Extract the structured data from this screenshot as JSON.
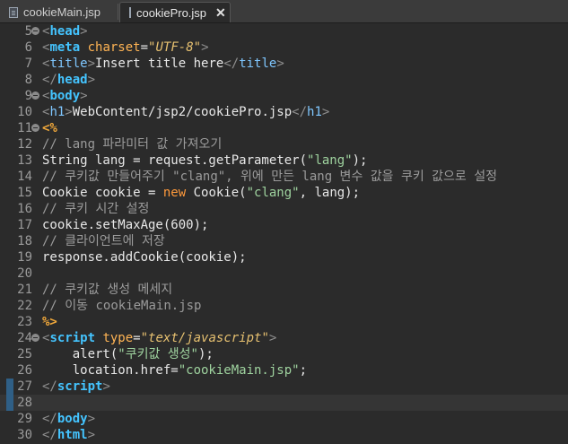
{
  "tabs": [
    {
      "label": "cookieMain.jsp",
      "active": false
    },
    {
      "label": "cookiePro.jsp",
      "active": true,
      "close": "✕"
    }
  ],
  "editor": {
    "current_line": 28,
    "lines": [
      {
        "n": "5",
        "fold": true,
        "tokens": [
          [
            "br",
            "<"
          ],
          [
            "tag",
            "head"
          ],
          [
            "br",
            ">"
          ]
        ]
      },
      {
        "n": "6",
        "tokens": [
          [
            "br",
            "<"
          ],
          [
            "tag",
            "meta"
          ],
          [
            "pl",
            " "
          ],
          [
            "attr",
            "charset"
          ],
          [
            "pl",
            "="
          ],
          [
            "attrv",
            "\"UTF-8\""
          ],
          [
            "br",
            ">"
          ]
        ]
      },
      {
        "n": "7",
        "tokens": [
          [
            "br",
            "<"
          ],
          [
            "tagn",
            "title"
          ],
          [
            "br",
            ">"
          ],
          [
            "pl",
            "Insert title here"
          ],
          [
            "br",
            "</"
          ],
          [
            "tagn",
            "title"
          ],
          [
            "br",
            ">"
          ]
        ]
      },
      {
        "n": "8",
        "tokens": [
          [
            "br",
            "</"
          ],
          [
            "tag",
            "head"
          ],
          [
            "br",
            ">"
          ]
        ]
      },
      {
        "n": "9",
        "fold": true,
        "tokens": [
          [
            "br",
            "<"
          ],
          [
            "tag",
            "body"
          ],
          [
            "br",
            ">"
          ]
        ]
      },
      {
        "n": "10",
        "tokens": [
          [
            "br",
            "<"
          ],
          [
            "tagn",
            "h1"
          ],
          [
            "br",
            ">"
          ],
          [
            "pl",
            "WebContent/jsp2/cookiePro.jsp"
          ],
          [
            "br",
            "</"
          ],
          [
            "tagn",
            "h1"
          ],
          [
            "br",
            ">"
          ]
        ]
      },
      {
        "n": "11",
        "fold": true,
        "tokens": [
          [
            "pct",
            "<%"
          ]
        ]
      },
      {
        "n": "12",
        "tokens": [
          [
            "com",
            "// lang 파라미터 값 가져오기"
          ]
        ]
      },
      {
        "n": "13",
        "tokens": [
          [
            "pl",
            "String lang = request.getParameter("
          ],
          [
            "str",
            "\"lang\""
          ],
          [
            "pl",
            ");"
          ]
        ]
      },
      {
        "n": "14",
        "tokens": [
          [
            "com",
            "// 쿠키값 만들어주기 \"clang\", 위에 만든 lang 변수 값을 쿠키 값으로 설정"
          ]
        ]
      },
      {
        "n": "15",
        "tokens": [
          [
            "pl",
            "Cookie cookie = "
          ],
          [
            "kw",
            "new"
          ],
          [
            "pl",
            " Cookie("
          ],
          [
            "str",
            "\"clang\""
          ],
          [
            "pl",
            ", lang);"
          ]
        ]
      },
      {
        "n": "16",
        "tokens": [
          [
            "com",
            "// 쿠키 시간 설정"
          ]
        ]
      },
      {
        "n": "17",
        "tokens": [
          [
            "pl",
            "cookie.setMaxAge(600);"
          ]
        ]
      },
      {
        "n": "18",
        "tokens": [
          [
            "com",
            "// 클라이언트에 저장"
          ]
        ]
      },
      {
        "n": "19",
        "tokens": [
          [
            "pl",
            "response.addCookie(cookie);"
          ]
        ]
      },
      {
        "n": "20",
        "tokens": []
      },
      {
        "n": "21",
        "tokens": [
          [
            "com",
            "// 쿠키값 생성 메세지"
          ]
        ]
      },
      {
        "n": "22",
        "tokens": [
          [
            "com",
            "// 이동 cookieMain.jsp"
          ]
        ]
      },
      {
        "n": "23",
        "tokens": [
          [
            "pct",
            "%>"
          ]
        ]
      },
      {
        "n": "24",
        "fold": true,
        "tokens": [
          [
            "br",
            "<"
          ],
          [
            "tag",
            "script"
          ],
          [
            "pl",
            " "
          ],
          [
            "attr",
            "type"
          ],
          [
            "pl",
            "="
          ],
          [
            "attrv",
            "\"text/javascript\""
          ],
          [
            "br",
            ">"
          ]
        ]
      },
      {
        "n": "25",
        "tokens": [
          [
            "pl",
            "    alert("
          ],
          [
            "str",
            "\"쿠키값 생성\""
          ],
          [
            "pl",
            ");"
          ]
        ]
      },
      {
        "n": "26",
        "tokens": [
          [
            "pl",
            "    location.href="
          ],
          [
            "str",
            "\"cookieMain.jsp\""
          ],
          [
            "pl",
            ";"
          ]
        ]
      },
      {
        "n": "27",
        "mark": true,
        "tokens": [
          [
            "br",
            "</"
          ],
          [
            "tag",
            "script"
          ],
          [
            "br",
            ">"
          ]
        ]
      },
      {
        "n": "28",
        "mark": true,
        "tokens": []
      },
      {
        "n": "29",
        "tokens": [
          [
            "br",
            "</"
          ],
          [
            "tag",
            "body"
          ],
          [
            "br",
            ">"
          ]
        ]
      },
      {
        "n": "30",
        "tokens": [
          [
            "br",
            "</"
          ],
          [
            "tag",
            "html"
          ],
          [
            "br",
            ">"
          ]
        ]
      }
    ]
  }
}
